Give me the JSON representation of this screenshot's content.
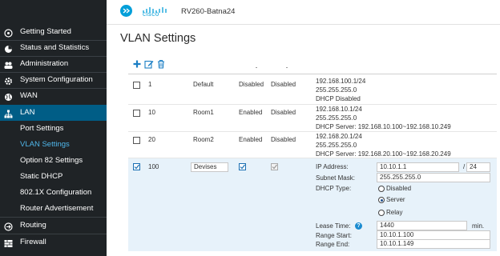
{
  "header": {
    "brand": "cisco",
    "device_name": "RV260-Batna24"
  },
  "sidebar": {
    "items": [
      {
        "label": "Getting Started",
        "icon": "getting-started-icon"
      },
      {
        "label": "Status and Statistics",
        "icon": "status-icon"
      },
      {
        "label": "Administration",
        "icon": "administration-icon"
      },
      {
        "label": "System Configuration",
        "icon": "gear-icon"
      },
      {
        "label": "WAN",
        "icon": "globe-icon"
      },
      {
        "label": "LAN",
        "icon": "network-icon"
      },
      {
        "label": "Port Settings"
      },
      {
        "label": "VLAN Settings",
        "selected": true
      },
      {
        "label": "Option 82 Settings"
      },
      {
        "label": "Static DHCP"
      },
      {
        "label": "802.1X Configuration"
      },
      {
        "label": "Router Advertisement"
      },
      {
        "label": "Routing",
        "icon": "routing-icon"
      },
      {
        "label": "Firewall",
        "icon": "firewall-icon"
      }
    ]
  },
  "page": {
    "title": "VLAN Settings"
  },
  "toolbar": {
    "add": "add-icon",
    "edit": "edit-icon",
    "delete": "trash-icon"
  },
  "vlans": [
    {
      "id": "1",
      "name": "Default",
      "inter_vlan": "Disabled",
      "mgmt": "Disabled",
      "ip": "192.168.100.1/24",
      "mask": "255.255.255.0",
      "dhcp": "DHCP Disabled"
    },
    {
      "id": "10",
      "name": "Room1",
      "inter_vlan": "Enabled",
      "mgmt": "Disabled",
      "ip": "192.168.10.1/24",
      "mask": "255.255.255.0",
      "dhcp": "DHCP Server: 192.168.10.100~192.168.10.249"
    },
    {
      "id": "20",
      "name": "Room2",
      "inter_vlan": "Enabled",
      "mgmt": "Disabled",
      "ip": "192.168.20.1/24",
      "mask": "255.255.255.0",
      "dhcp": "DHCP Server: 192.168.20.100~192.168.20.249"
    }
  ],
  "edit_row": {
    "id": "100",
    "name_value": "Devises",
    "labels": {
      "ip": "IP Address:",
      "mask": "Subnet Mask:",
      "dhcp_type": "DHCP Type:",
      "lease": "Lease Time:",
      "range_start": "Range Start:",
      "range_end": "Range End:"
    },
    "ip_value": "10.10.1.1",
    "slash": "/",
    "prefix_value": "24",
    "mask_value": "255.255.255.0",
    "dhcp_options": [
      "Disabled",
      "Server",
      "Relay"
    ],
    "dhcp_selected": "Server",
    "help": "?",
    "lease_value": "1440",
    "lease_unit": "min.",
    "range_start_value": "10.10.1.100",
    "range_end_value": "10.10.1.149"
  },
  "colors": {
    "sidebar": "#1f2326",
    "lan_active": "#005d86",
    "selected_text": "#4fb6ea",
    "accent": "#049fd9",
    "selected_row": "#e7f2fa"
  }
}
